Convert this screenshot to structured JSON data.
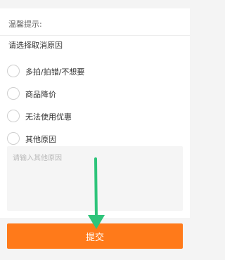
{
  "tip": {
    "title": "温馨提示:"
  },
  "subtitle": "请选择取消原因",
  "options": [
    {
      "label": "多拍/拍错/不想要"
    },
    {
      "label": "商品降价"
    },
    {
      "label": "无法使用优惠"
    },
    {
      "label": "其他原因"
    }
  ],
  "reason_input": {
    "placeholder": "请输入其他原因"
  },
  "submit": {
    "label": "提交"
  },
  "colors": {
    "accent": "#ff7a1a",
    "annotation_arrow": "#2ec47a"
  }
}
